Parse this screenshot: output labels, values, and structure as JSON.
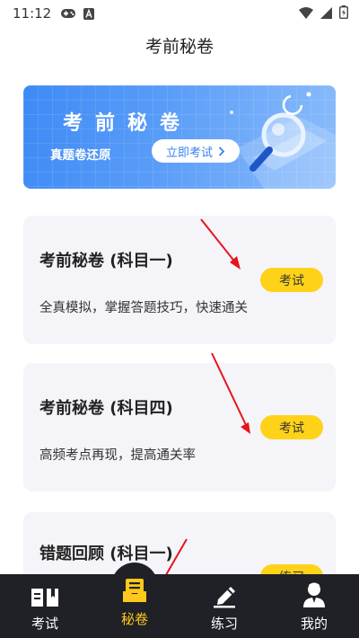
{
  "status_bar": {
    "time": "11:12",
    "icons": [
      "gamepad-icon",
      "a-notification-icon",
      "wifi-icon",
      "signal-icon",
      "battery-icon"
    ]
  },
  "header": {
    "title": "考前秘卷"
  },
  "banner": {
    "title": "考前秘卷",
    "subtitle": "真题卷还原",
    "button_label": "立即考试"
  },
  "cards": [
    {
      "title": "考前秘卷 (科目一)",
      "description": "全真模拟，掌握答题技巧，快速通关",
      "button_label": "考试"
    },
    {
      "title": "考前秘卷 (科目四)",
      "description": "高频考点再现，提高通关率",
      "button_label": "考试"
    },
    {
      "title": "错题回顾 (科目一)",
      "description": "",
      "button_label": "练习"
    }
  ],
  "tabbar": {
    "items": [
      {
        "label": "考试",
        "icon": "book-icon",
        "active": false
      },
      {
        "label": "秘卷",
        "icon": "paper-tray-icon",
        "active": true
      },
      {
        "label": "练习",
        "icon": "pencil-icon",
        "active": false
      },
      {
        "label": "我的",
        "icon": "profile-icon",
        "active": false
      }
    ]
  },
  "colors": {
    "accent_yellow": "#ffd21a",
    "active_tab": "#ffc81a",
    "banner_blue": "#3e8af5",
    "tabbar_bg": "#1f2127",
    "card_bg": "#f4f4f9",
    "annotation_red": "#e8131b"
  }
}
